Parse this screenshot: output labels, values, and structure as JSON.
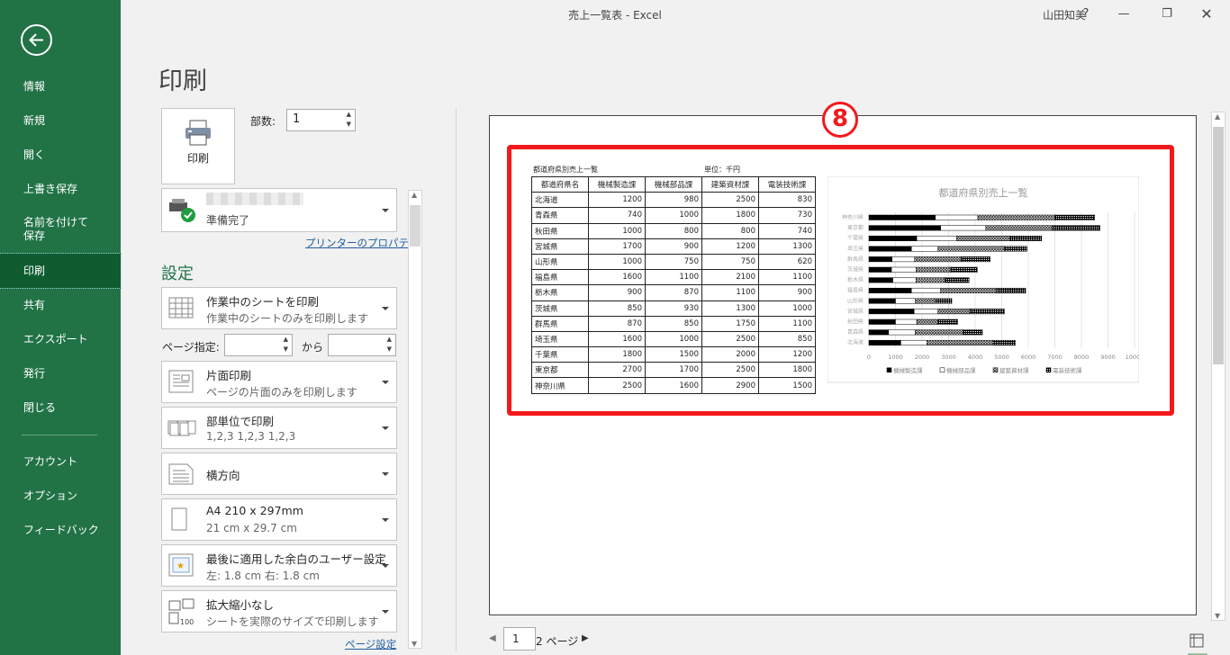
{
  "window": {
    "title": "売上一覧表  -  Excel",
    "user": "山田知美",
    "help": "?"
  },
  "nav": {
    "items": [
      "情報",
      "新規",
      "開く",
      "上書き保存",
      "名前を付けて\n保存",
      "印刷",
      "共有",
      "エクスポート",
      "発行",
      "閉じる"
    ],
    "items2": [
      "アカウント",
      "オプション",
      "フィードバック"
    ]
  },
  "print": {
    "heading": "印刷",
    "button": "印刷",
    "copies_label": "部数:",
    "copies": "1",
    "printer_status": "準備完了",
    "printer_props": "プリンターのプロパティ",
    "settings": "設定",
    "pages_label": "ページ指定:",
    "to_label": "から",
    "page_setup": "ページ設定"
  },
  "options": [
    {
      "t1": "作業中のシートを印刷",
      "t2": "作業中のシートのみを印刷します"
    },
    {
      "t1": "片面印刷",
      "t2": "ページの片面のみを印刷します"
    },
    {
      "t1": "部単位で印刷",
      "t2": "1,2,3    1,2,3    1,2,3"
    },
    {
      "t1": "横方向",
      "t2": ""
    },
    {
      "t1": "A4 210 x 297mm",
      "t2": "21 cm x 29.7 cm"
    },
    {
      "t1": "最後に適用した余白のユーザー設定",
      "t2": "左:  1.8 cm    右:  1.8 cm"
    },
    {
      "t1": "拡大縮小なし",
      "t2": "シートを実際のサイズで印刷します"
    }
  ],
  "preview": {
    "badge": "8",
    "sheet_title": "都道府県別売上一覧",
    "unit": "単位：千円",
    "page": "1",
    "of_pages": "2 ページ"
  },
  "table": {
    "headers": [
      "都道府県名",
      "機械製造課",
      "機械部品課",
      "建築資材課",
      "電装技術課"
    ],
    "rows": [
      [
        "北海道",
        "1200",
        "980",
        "2500",
        "830"
      ],
      [
        "青森県",
        "740",
        "1000",
        "1800",
        "730"
      ],
      [
        "秋田県",
        "1000",
        "800",
        "800",
        "740"
      ],
      [
        "宮城県",
        "1700",
        "900",
        "1200",
        "1300"
      ],
      [
        "山形県",
        "1000",
        "750",
        "750",
        "620"
      ],
      [
        "福島県",
        "1600",
        "1100",
        "2100",
        "1100"
      ],
      [
        "栃木県",
        "900",
        "870",
        "1100",
        "900"
      ],
      [
        "茨城県",
        "850",
        "930",
        "1300",
        "1000"
      ],
      [
        "群馬県",
        "870",
        "850",
        "1750",
        "1100"
      ],
      [
        "埼玉県",
        "1600",
        "1000",
        "2500",
        "850"
      ],
      [
        "千葉県",
        "1800",
        "1500",
        "2000",
        "1200"
      ],
      [
        "東京都",
        "2700",
        "1700",
        "2500",
        "1800"
      ],
      [
        "神奈川県",
        "2500",
        "1600",
        "2900",
        "1500"
      ]
    ]
  },
  "chart_data": {
    "type": "bar",
    "title": "都道府県別売上一覧",
    "stacked": true,
    "horizontal": true,
    "categories": [
      "神奈川県",
      "東京都",
      "千葉県",
      "埼玉県",
      "群馬県",
      "茨城県",
      "栃木県",
      "福島県",
      "山形県",
      "宮城県",
      "秋田県",
      "青森県",
      "北海道"
    ],
    "series": [
      {
        "name": "機械製造課",
        "values": [
          2500,
          2700,
          1800,
          1600,
          870,
          850,
          900,
          1600,
          1000,
          1700,
          1000,
          740,
          1200
        ]
      },
      {
        "name": "機械部品課",
        "values": [
          1600,
          1700,
          1500,
          1000,
          850,
          930,
          870,
          1100,
          750,
          900,
          800,
          1000,
          980
        ]
      },
      {
        "name": "建築資材課",
        "values": [
          2900,
          2500,
          2000,
          2500,
          1750,
          1300,
          1100,
          2100,
          750,
          1200,
          800,
          1800,
          2500
        ]
      },
      {
        "name": "電装技術課",
        "values": [
          1500,
          1800,
          1200,
          850,
          1100,
          1000,
          900,
          1100,
          620,
          1300,
          740,
          730,
          830
        ]
      }
    ],
    "xlim": [
      0,
      10000
    ],
    "xticks": [
      "0",
      "1000",
      "2000",
      "3000",
      "4000",
      "5000",
      "6000",
      "7000",
      "8000",
      "9000",
      "10000"
    ],
    "legend": "bottom"
  }
}
